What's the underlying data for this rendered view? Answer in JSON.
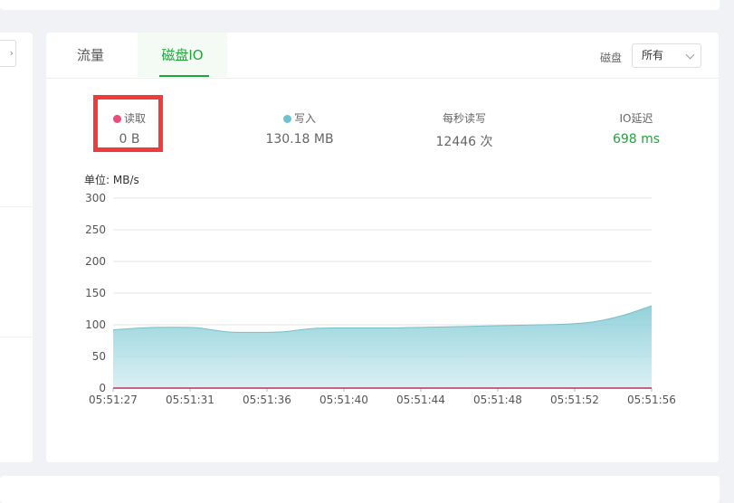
{
  "tabs": [
    {
      "label": "流量",
      "active": false
    },
    {
      "label": "磁盘IO",
      "active": true
    }
  ],
  "disk_filter": {
    "label": "磁盘",
    "value": "所有"
  },
  "stats": {
    "read": {
      "label": "读取",
      "value": "0 B",
      "color": "#ee4b7b"
    },
    "write": {
      "label": "写入",
      "value": "130.18 MB",
      "color": "#6cc2d2"
    },
    "iops": {
      "label": "每秒读写",
      "value": "12446 次"
    },
    "latency": {
      "label": "IO延迟",
      "value": "698 ms",
      "color": "#20a53a"
    }
  },
  "unit": "单位:  MB/s",
  "colors": {
    "accent": "#20a53a",
    "highlight": "#ef3b3e",
    "write_area": "#8dd0d8",
    "read_line": "#c0305a"
  },
  "chart_data": {
    "type": "area",
    "ylim": [
      0,
      300
    ],
    "yticks": [
      "300",
      "250",
      "200",
      "150",
      "100",
      "50",
      "0"
    ],
    "xticks": [
      "05:51:27",
      "05:51:31",
      "05:51:36",
      "05:51:40",
      "05:51:44",
      "05:51:48",
      "05:51:52",
      "05:51:56"
    ],
    "series": [
      {
        "name": "写入",
        "values": [
          92,
          95,
          96,
          95,
          89,
          88,
          89,
          94,
          95,
          95,
          95,
          96,
          97,
          98,
          99,
          100,
          101,
          105,
          115,
          130
        ]
      },
      {
        "name": "读取",
        "values": [
          0,
          0,
          0,
          0,
          0,
          0,
          0,
          0,
          0,
          0,
          0,
          0,
          0,
          0,
          0,
          0,
          0,
          0,
          0,
          0
        ]
      }
    ]
  }
}
